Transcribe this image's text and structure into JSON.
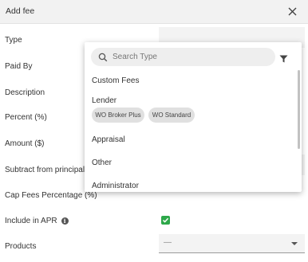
{
  "header": {
    "title": "Add fee",
    "close_icon": "close-icon"
  },
  "form": {
    "labels": {
      "type": "Type",
      "paid_by": "Paid By",
      "description": "Description",
      "percent": "Percent (%)",
      "amount": "Amount ($)",
      "subtract": "Subtract from principal",
      "cap_fees": "Cap Fees Percentage (%)",
      "include_apr": "Include in APR",
      "products": "Products"
    },
    "include_apr_checked": true,
    "info_icon": "i",
    "products_value": "—"
  },
  "dropdown": {
    "search_placeholder": "Search Type",
    "options": {
      "custom_fees": "Custom Fees",
      "lender": "Lender",
      "appraisal": "Appraisal",
      "other": "Other",
      "administrator": "Administrator"
    },
    "chips": [
      "WO Broker Plus",
      "WO Standard"
    ]
  },
  "colors": {
    "checkbox": "#2ea84a",
    "header_bg": "#f2f2f2"
  }
}
